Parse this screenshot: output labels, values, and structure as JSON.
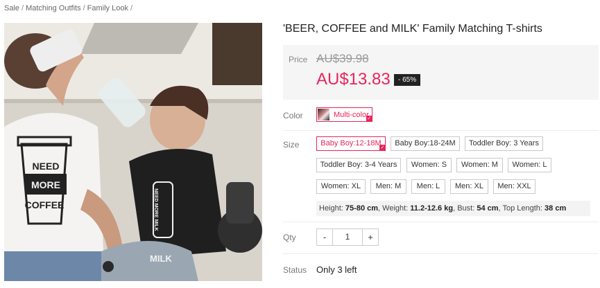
{
  "breadcrumb": {
    "items": [
      "Sale",
      "Matching Outfits",
      "Family Look"
    ],
    "trailing": "/"
  },
  "product": {
    "title": "'BEER, COFFEE and MILK' Family Matching T-shirts",
    "image": {
      "mug_text": [
        "NEED",
        "MORE",
        "COFFEE"
      ],
      "bottle_text": "NEED MORE MILK",
      "pants_text": "MILK"
    }
  },
  "price": {
    "label": "Price",
    "original": "AU$39.98",
    "current": "AU$13.83",
    "discount": "- 65%"
  },
  "color": {
    "label": "Color",
    "selected": "Multi-color"
  },
  "size": {
    "label": "Size",
    "options": [
      "Baby Boy:12-18M",
      "Baby Boy:18-24M",
      "Toddler Boy: 3 Years",
      "Toddler Boy: 3-4 Years",
      "Women: S",
      "Women: M",
      "Women: L",
      "Women: XL",
      "Men: M",
      "Men: L",
      "Men: XL",
      "Men: XXL"
    ],
    "selected": "Baby Boy:12-18M",
    "info": {
      "height_label": "Height:",
      "height": "75-80 cm",
      "weight_label": "Weight:",
      "weight": "11.2-12.6 kg",
      "bust_label": "Bust:",
      "bust": "54 cm",
      "length_label": "Top Length:",
      "length": "38 cm"
    }
  },
  "qty": {
    "label": "Qty",
    "minus": "-",
    "value": "1",
    "plus": "+"
  },
  "status": {
    "label": "Status",
    "value": "Only 3 left"
  },
  "colors": {
    "accent": "#e8245a",
    "badge_bg": "#222222",
    "price_bg": "#f5f5f5"
  }
}
